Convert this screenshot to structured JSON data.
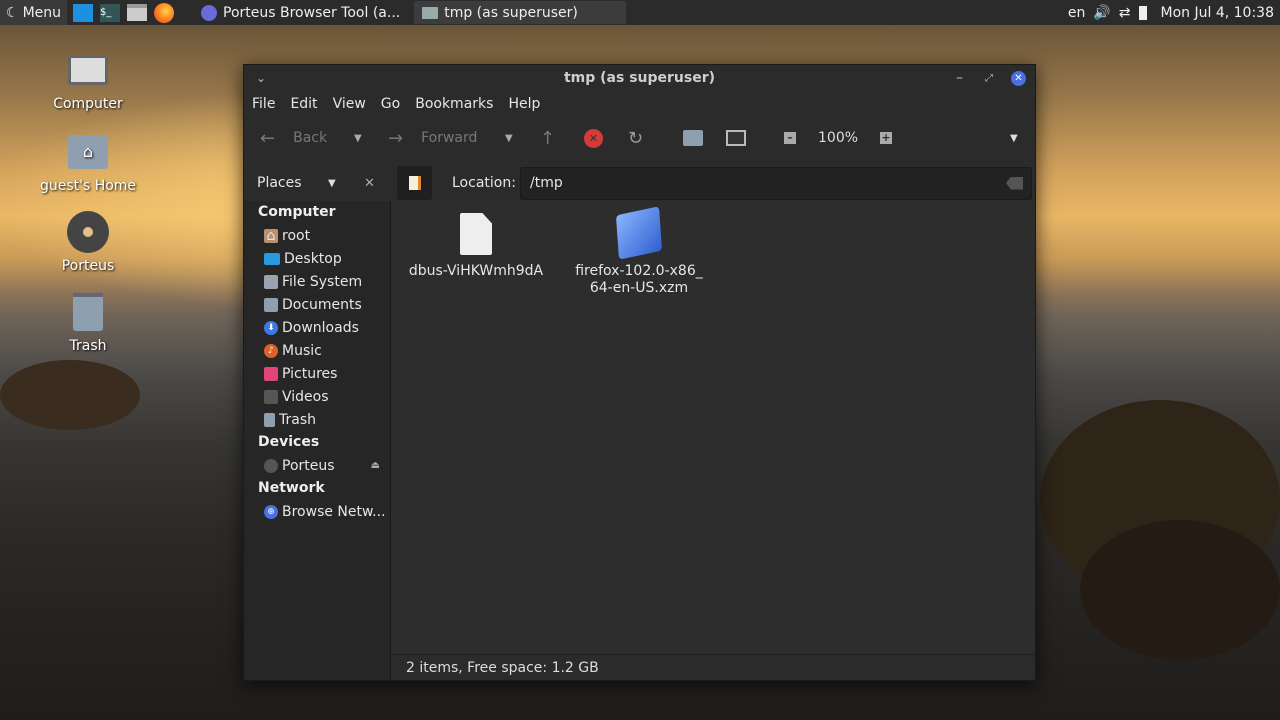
{
  "taskbar": {
    "menu_label": "Menu",
    "tasks": [
      {
        "label": "Porteus Browser Tool (a..."
      },
      {
        "label": "tmp (as superuser)"
      }
    ],
    "lang": "en",
    "clock": "Mon Jul  4, 10:38"
  },
  "desktop": {
    "icons": [
      {
        "label": "Computer"
      },
      {
        "label": "guest's Home"
      },
      {
        "label": "Porteus"
      },
      {
        "label": "Trash"
      }
    ]
  },
  "window": {
    "title": "tmp (as superuser)",
    "menu": [
      "File",
      "Edit",
      "View",
      "Go",
      "Bookmarks",
      "Help"
    ],
    "toolbar": {
      "back": "Back",
      "forward": "Forward",
      "zoom": "100%"
    },
    "sidebar_header": "Places",
    "location_label": "Location:",
    "location_value": "/tmp",
    "sidebar": {
      "computer": "Computer",
      "items": [
        "root",
        "Desktop",
        "File System",
        "Documents",
        "Downloads",
        "Music",
        "Pictures",
        "Videos",
        "Trash"
      ],
      "devices": "Devices",
      "device_items": [
        "Porteus"
      ],
      "network": "Network",
      "network_items": [
        "Browse Netw..."
      ]
    },
    "files": [
      {
        "name_line1": "dbus-ViHKWmh9dA",
        "name_line2": ""
      },
      {
        "name_line1": "firefox-102.0-x86_",
        "name_line2": "64-en-US.xzm"
      }
    ],
    "status": "2 items, Free space: 1.2 GB"
  },
  "colors": {
    "accent": "#3d7ae6",
    "close": "#4a6fe0",
    "stop": "#d53a3a"
  }
}
